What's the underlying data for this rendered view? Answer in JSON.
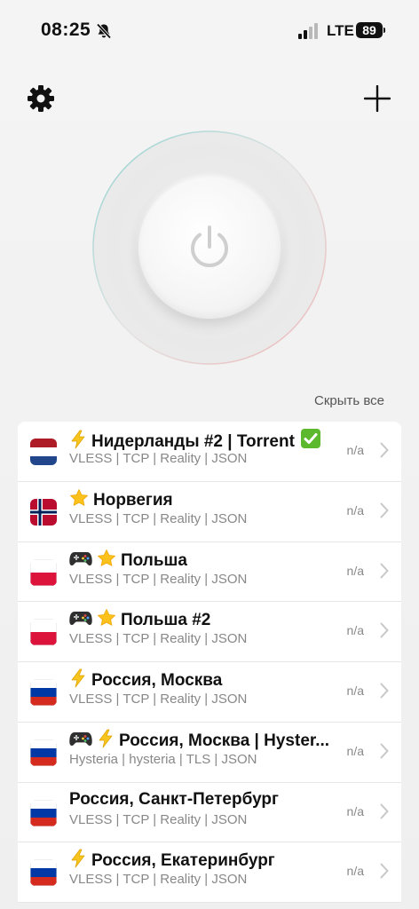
{
  "status_bar": {
    "time": "08:25",
    "network": "LTE",
    "battery": "89"
  },
  "header": {
    "settings_icon": "gear-icon",
    "add_icon": "plus-icon"
  },
  "power": {
    "icon": "power-icon"
  },
  "list": {
    "hide_all_label": "Скрыть все",
    "servers": [
      {
        "name": "Нидерланды #2 | Torrent",
        "emojis": [
          "bolt"
        ],
        "suffix": "check",
        "flag": "nl",
        "protocol": "VLESS | TCP | Reality | JSON",
        "ping": "n/a"
      },
      {
        "name": "Норвегия",
        "emojis": [
          "star"
        ],
        "flag": "no",
        "protocol": "VLESS | TCP | Reality | JSON",
        "ping": "n/a"
      },
      {
        "name": "Польша",
        "emojis": [
          "gamepad",
          "star"
        ],
        "flag": "pl",
        "protocol": "VLESS | TCP | Reality | JSON",
        "ping": "n/a"
      },
      {
        "name": "Польша #2",
        "emojis": [
          "gamepad",
          "star"
        ],
        "flag": "pl",
        "protocol": "VLESS | TCP | Reality | JSON",
        "ping": "n/a"
      },
      {
        "name": "Россия, Москва",
        "emojis": [
          "bolt"
        ],
        "flag": "ru",
        "protocol": "VLESS | TCP | Reality | JSON",
        "ping": "n/a"
      },
      {
        "name": "Россия, Москва | Hyster...",
        "emojis": [
          "gamepad",
          "bolt"
        ],
        "flag": "ru",
        "protocol": "Hysteria | hysteria | TLS | JSON",
        "ping": "n/a"
      },
      {
        "name": "Россия, Санкт-Петербург",
        "emojis": [],
        "flag": "ru",
        "protocol": "VLESS | TCP | Reality | JSON",
        "ping": "n/a"
      },
      {
        "name": "Россия, Екатеринбург",
        "emojis": [
          "bolt"
        ],
        "flag": "ru",
        "protocol": "VLESS | TCP | Reality | JSON",
        "ping": "n/a"
      }
    ]
  }
}
